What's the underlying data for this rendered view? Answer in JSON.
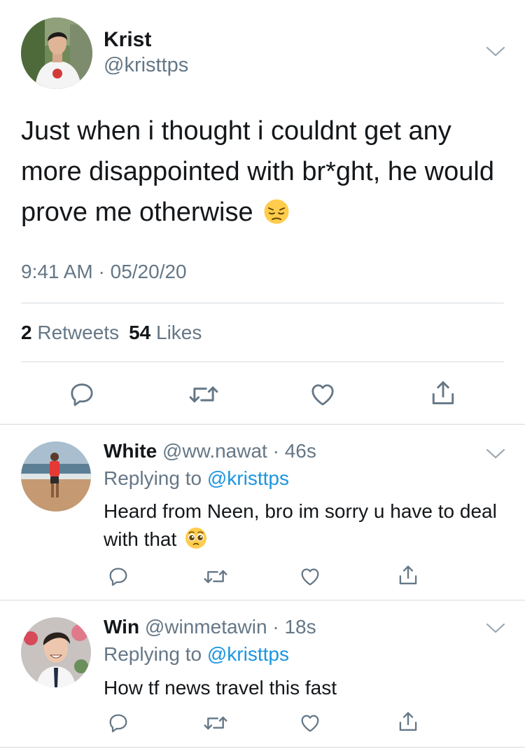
{
  "main_tweet": {
    "author_name": "Krist",
    "author_handle": "@kristtps",
    "text": "Just when i thought i couldnt get any more disappointed with br*ght, he would prove me otherwise",
    "emoji": "pensive-face",
    "time": "9:41 AM",
    "time_separator": " · ",
    "date": "05/20/20",
    "retweets_count": "2",
    "retweets_label": "Retweets",
    "likes_count": "54",
    "likes_label": "Likes"
  },
  "replies": [
    {
      "name": "White",
      "handle": "@ww.nawat",
      "separator": " · ",
      "age": "46s",
      "replying_prefix": "Replying to ",
      "replying_to": "@kristtps",
      "text": "Heard from Neen, bro im sorry u have to deal with that",
      "emoji": "pleading-face"
    },
    {
      "name": "Win",
      "handle": "@winmetawin",
      "separator": " · ",
      "age": "18s",
      "replying_prefix": "Replying to ",
      "replying_to": "@kristtps",
      "text": "How tf news travel this fast"
    }
  ],
  "colors": {
    "text": "#14171a",
    "secondary": "#657786",
    "link": "#1b95e0",
    "divider": "#d5dbe0"
  }
}
